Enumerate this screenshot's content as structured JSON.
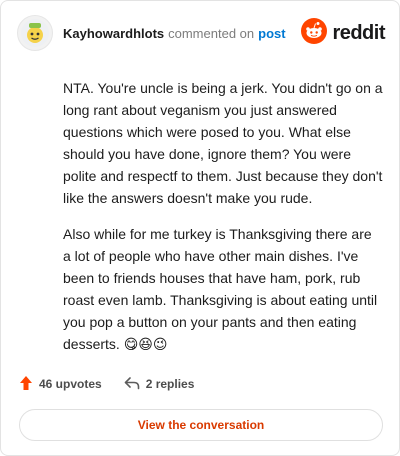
{
  "header": {
    "username": "Kayhowardhlots",
    "verb": "commented on",
    "target": "post",
    "brand": "reddit"
  },
  "comment": {
    "paragraphs": [
      "NTA. You're uncle is being a jerk. You didn't go on a long rant about veganism you just answered questions which were posed to you. What else should you have done, ignore them? You were polite and respectf to them. Just because they don't like the answers doesn't make you rude.",
      "Also while for me turkey is Thanksgiving there are a lot of people who have other main dishes. I've been to friends houses that have ham, pork, rub roast even lamb. Thanksgiving is about eating until you pop a button on your pants and then eating desserts. 😋😆😉"
    ]
  },
  "footer": {
    "upvotes": "46 upvotes",
    "replies": "2 replies",
    "cta": "View the conversation"
  },
  "colors": {
    "brand_orange": "#ff4500",
    "link_blue": "#0079d3",
    "cta_text": "#d93a00"
  },
  "icons": {
    "avatar": "avatar-icon",
    "logo": "reddit-logo-icon",
    "upvote": "upvote-icon",
    "reply": "reply-icon"
  }
}
